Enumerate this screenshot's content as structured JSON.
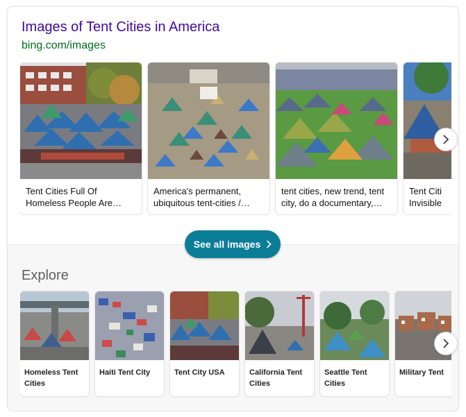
{
  "images_section": {
    "title": "Images of Tent Cities in America",
    "source": "bing.com/images",
    "tiles": [
      {
        "caption": "Tent Cities Full Of\nHomeless People Are…"
      },
      {
        "caption": "America's permanent,\nubiquitous tent-cities /…"
      },
      {
        "caption": "tent cities, new trend, tent\ncity, do a documentary,…"
      },
      {
        "caption": "Tent Citi\nInvisible"
      }
    ],
    "see_all_label": "See all images"
  },
  "explore_section": {
    "heading": "Explore",
    "tiles": [
      {
        "caption": "Homeless Tent Cities"
      },
      {
        "caption": "Haiti Tent City"
      },
      {
        "caption": "Tent City USA"
      },
      {
        "caption": "California Tent Cities"
      },
      {
        "caption": "Seattle Tent Cities"
      },
      {
        "caption": "Military Tent"
      }
    ]
  },
  "icons": {
    "next": "chevron-right-icon",
    "see_all": "chevron-right-icon"
  },
  "colors": {
    "title": "#4007a2",
    "source": "#006d21",
    "button": "#0c7d97"
  }
}
